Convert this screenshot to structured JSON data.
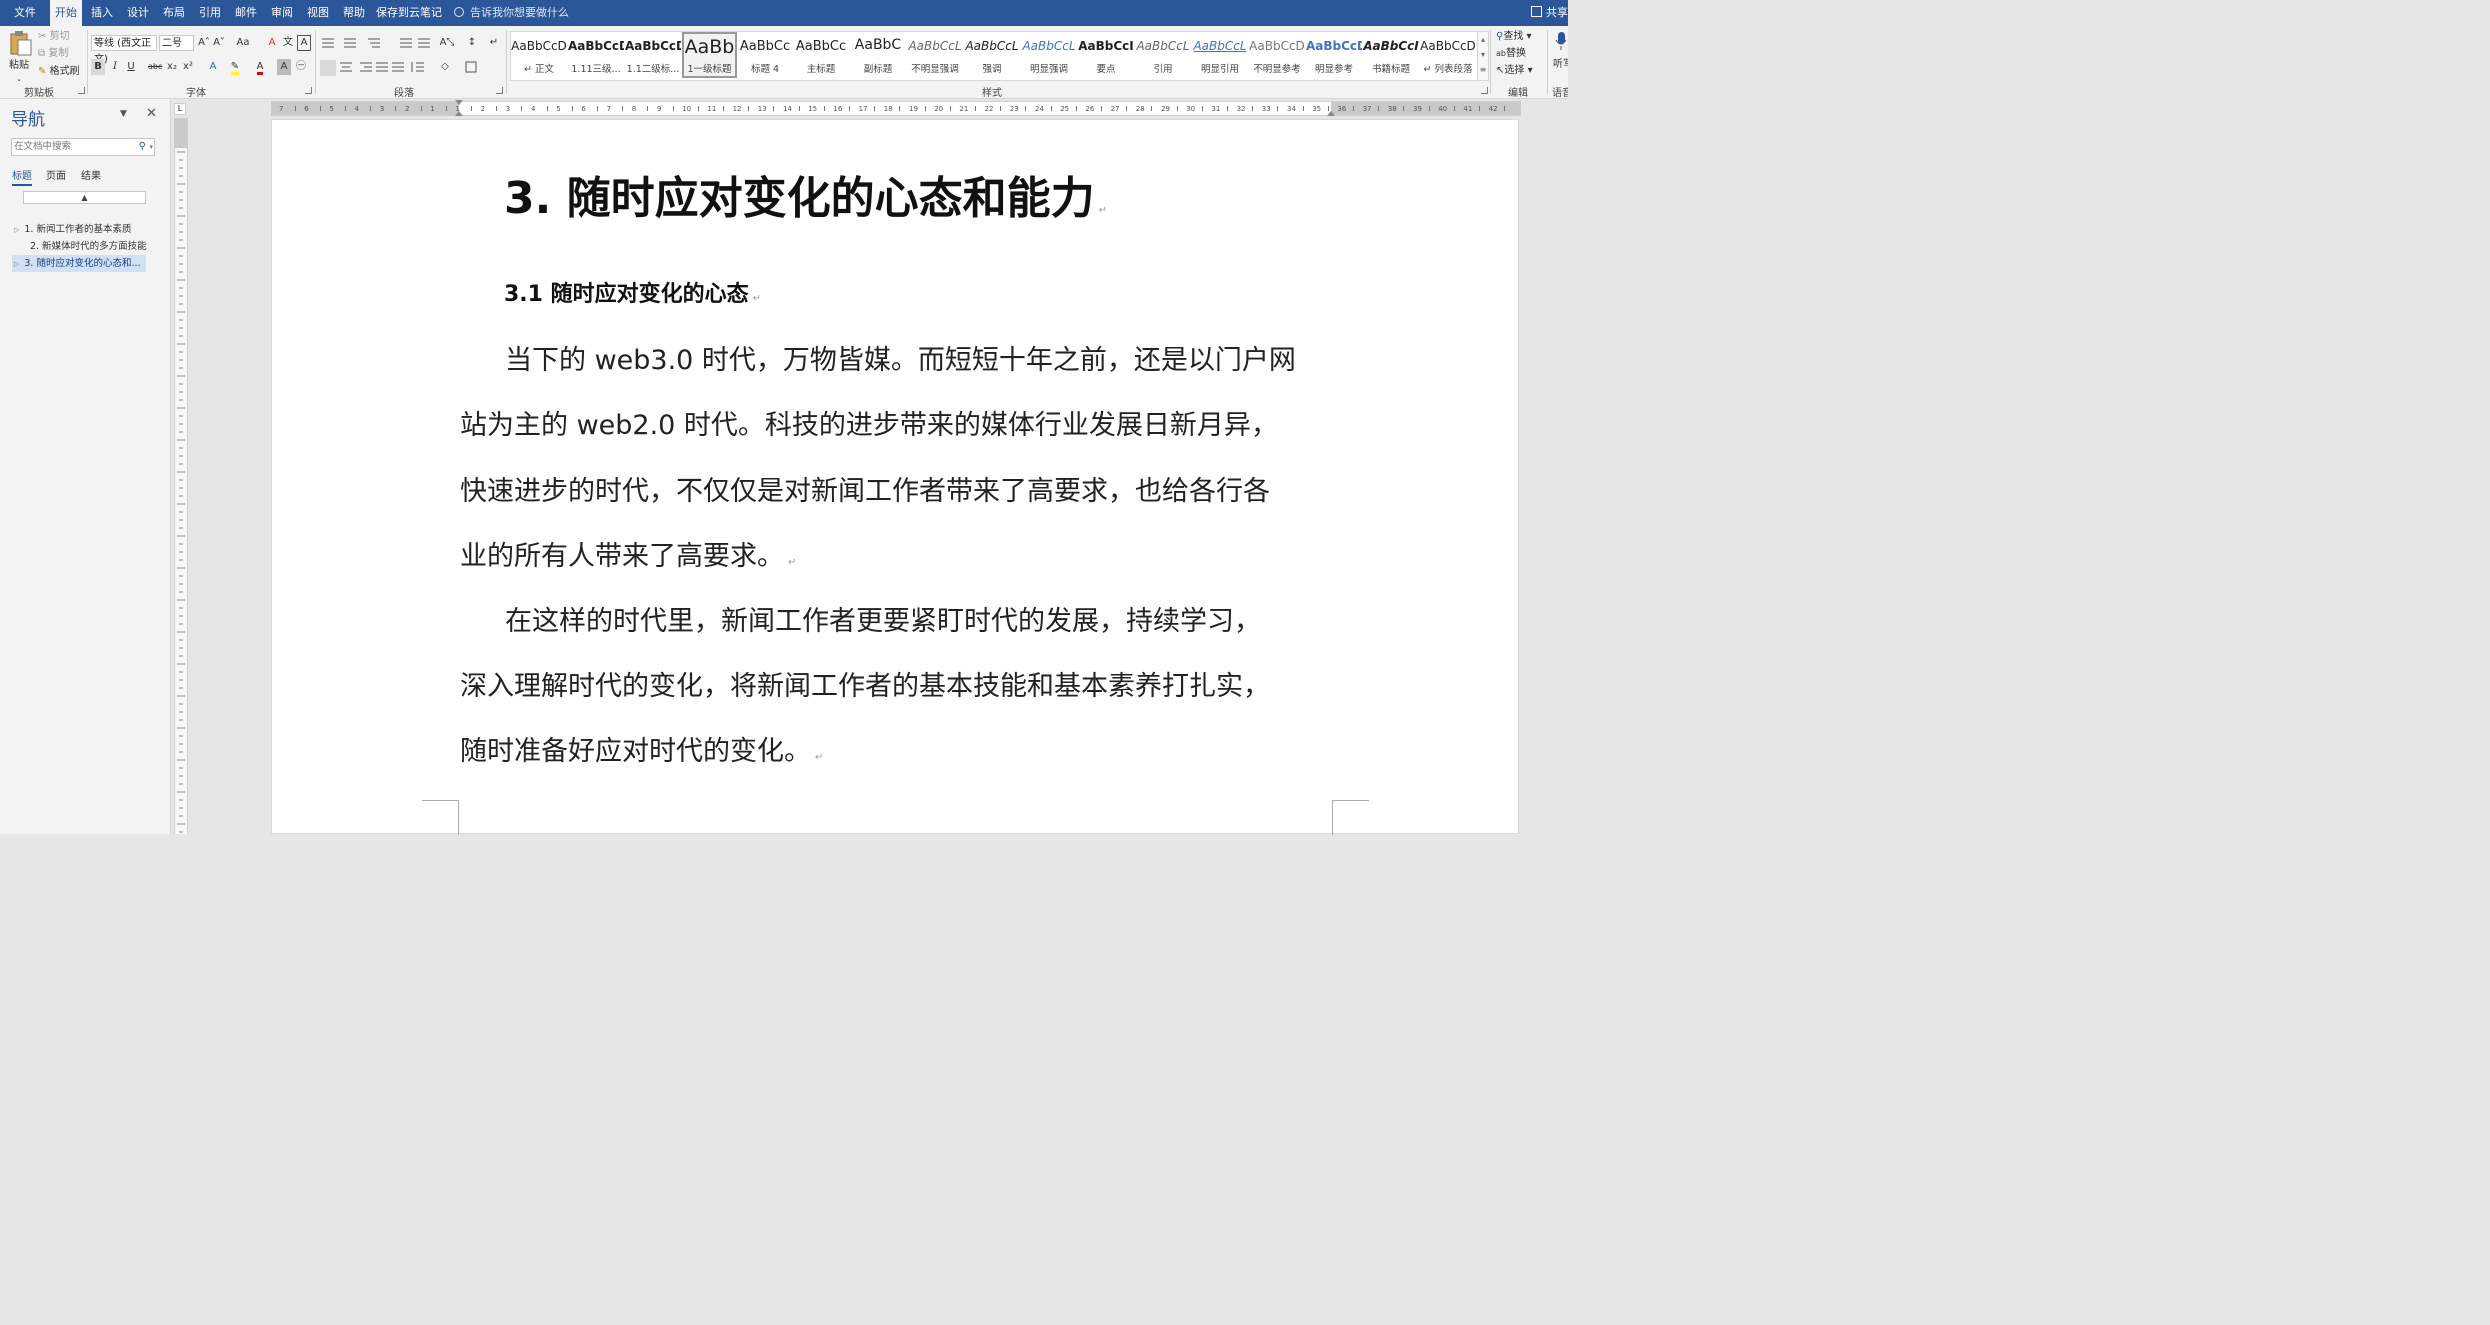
{
  "menubar": {
    "tabs": [
      {
        "label": "文件",
        "active": false
      },
      {
        "label": "开始",
        "active": true
      },
      {
        "label": "插入",
        "active": false
      },
      {
        "label": "设计",
        "active": false
      },
      {
        "label": "布局",
        "active": false
      },
      {
        "label": "引用",
        "active": false
      },
      {
        "label": "邮件",
        "active": false
      },
      {
        "label": "审阅",
        "active": false
      },
      {
        "label": "视图",
        "active": false
      },
      {
        "label": "帮助",
        "active": false
      },
      {
        "label": "保存到云笔记",
        "active": false
      }
    ],
    "tell_me": "告诉我你想要做什么",
    "share": "共享"
  },
  "ribbon": {
    "clipboard": {
      "paste": "粘贴",
      "cut": "剪切",
      "copy": "复制",
      "format_painter": "格式刷",
      "label": "剪贴板"
    },
    "font": {
      "font_name": "等线 (西文正文)",
      "font_size": "二号",
      "label": "字体",
      "bold": "B",
      "italic": "I",
      "underline": "U",
      "strike": "abc",
      "sub": "x₂",
      "sup": "x²",
      "grow": "A˄",
      "shrink": "A˅",
      "case": "Aa",
      "clear": "A",
      "phonetic": "文",
      "border": "A"
    },
    "paragraph": {
      "label": "段落"
    },
    "styles": {
      "label": "样式",
      "items": [
        {
          "sample": "AaBbCcD",
          "name": "↵ 正文",
          "selected": false
        },
        {
          "sample": "AaBbCcD",
          "name": "1.11三级...",
          "selected": false
        },
        {
          "sample": "AaBbCcD",
          "name": "1.1二级标...",
          "selected": false
        },
        {
          "sample": "AaBb",
          "name": "1一级标题",
          "selected": true
        },
        {
          "sample": "AaBbCc",
          "name": "标题 4",
          "selected": false
        },
        {
          "sample": "AaBbCc",
          "name": "主标题",
          "selected": false
        },
        {
          "sample": "AaBbC",
          "name": "副标题",
          "selected": false
        },
        {
          "sample": "AaBbCcL",
          "name": "不明显强调",
          "selected": false
        },
        {
          "sample": "AaBbCcL",
          "name": "强调",
          "selected": false
        },
        {
          "sample": "AaBbCcL",
          "name": "明显强调",
          "selected": false
        },
        {
          "sample": "AaBbCcI",
          "name": "要点",
          "selected": false
        },
        {
          "sample": "AaBbCcL",
          "name": "引用",
          "selected": false
        },
        {
          "sample": "AaBbCcL",
          "name": "明显引用",
          "selected": false
        },
        {
          "sample": "AaBbCcD",
          "name": "不明显参考",
          "selected": false
        },
        {
          "sample": "AaBbCcD",
          "name": "明显参考",
          "selected": false
        },
        {
          "sample": "AaBbCcI",
          "name": "书籍标题",
          "selected": false
        },
        {
          "sample": "AaBbCcD",
          "name": "↵ 列表段落",
          "selected": false
        }
      ]
    },
    "editing": {
      "find": "查找",
      "replace": "替换",
      "select": "选择",
      "label": "编辑"
    },
    "voice": {
      "dictate": "听写",
      "label": "语音"
    }
  },
  "navigation": {
    "title": "导航",
    "search_placeholder": "在文档中搜索",
    "tabs": [
      {
        "label": "标题",
        "active": true
      },
      {
        "label": "页面",
        "active": false
      },
      {
        "label": "结果",
        "active": false
      }
    ],
    "collapse_glyph": "▲",
    "items": [
      {
        "label": "1. 新闻工作者的基本素质",
        "has_children": true,
        "selected": false
      },
      {
        "label": "2. 新媒体时代的多方面技能",
        "has_children": false,
        "selected": false
      },
      {
        "label": "3. 随时应对变化的心态和...",
        "has_children": true,
        "selected": true
      }
    ]
  },
  "ruler": {
    "ticks": [
      "7",
      "6",
      "5",
      "4",
      "3",
      "2",
      "1",
      "1",
      "2",
      "3",
      "4",
      "5",
      "6",
      "7",
      "8",
      "9",
      "10",
      "11",
      "12",
      "13",
      "14",
      "15",
      "16",
      "17",
      "18",
      "19",
      "20",
      "21",
      "22",
      "23",
      "24",
      "25",
      "26",
      "27",
      "28",
      "29",
      "30",
      "31",
      "32",
      "33",
      "34",
      "35",
      "36",
      "37",
      "38",
      "39",
      "40",
      "41",
      "42"
    ]
  },
  "document": {
    "heading1": "3. 随时应对变化的心态和能力",
    "heading2": "3.1 随时应对变化的心态",
    "paragraph_mark": "↵",
    "para1_lines": [
      "当下的 web3.0 时代，万物皆媒。而短短十年之前，还是以门户网",
      "站为主的 web2.0 时代。科技的进步带来的媒体行业发展日新月异，",
      "快速进步的时代，不仅仅是对新闻工作者带来了高要求，也给各行各",
      "业的所有人带来了高要求。"
    ],
    "para2_lines": [
      "在这样的时代里，新闻工作者更要紧盯时代的发展，持续学习，",
      "深入理解时代的变化，将新闻工作者的基本技能和基本素养打扎实，",
      "随时准备好应对时代的变化。"
    ]
  },
  "colors": {
    "accent": "#2b579a",
    "nav_selected": "#cfe0f7"
  }
}
